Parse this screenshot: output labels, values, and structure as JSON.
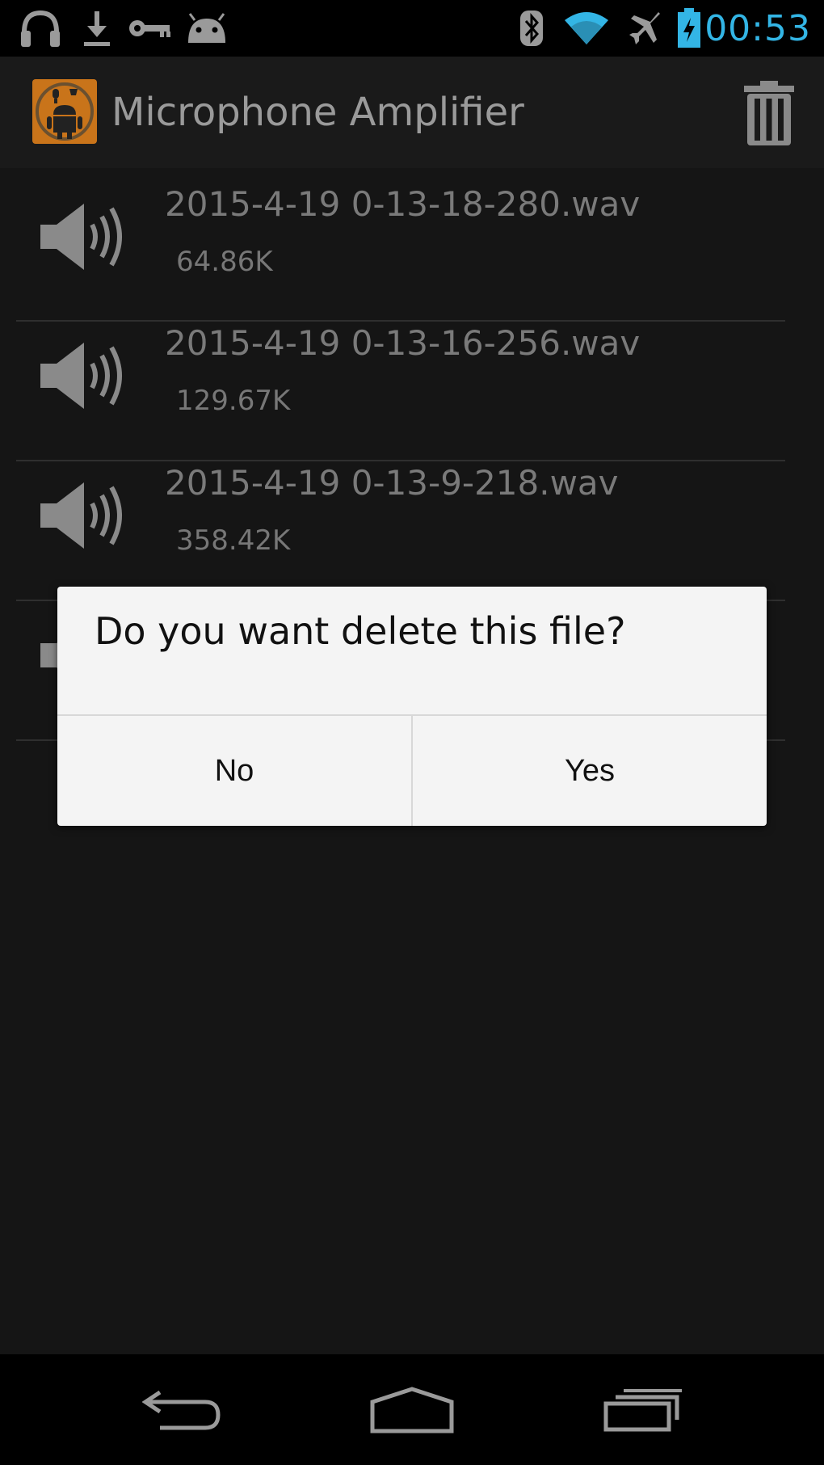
{
  "status_bar": {
    "time": "00:53",
    "left_icons": [
      "headphones-icon",
      "download-icon",
      "key-icon",
      "android-icon"
    ],
    "right_icons": [
      "bluetooth-icon",
      "wifi-icon",
      "airplane-icon",
      "battery-charging-icon"
    ],
    "time_color": "#33b5e5"
  },
  "action_bar": {
    "title": "Microphone Amplifier",
    "app_icon": "app-logo-icon",
    "action_icon": "trash-icon"
  },
  "files": [
    {
      "name": "2015-4-19 0-13-18-280.wav",
      "size": "64.86K"
    },
    {
      "name": "2015-4-19 0-13-16-256.wav",
      "size": "129.67K"
    },
    {
      "name": "2015-4-19 0-13-9-218.wav",
      "size": "358.42K"
    },
    {
      "name": "",
      "size": ""
    }
  ],
  "dialog": {
    "message": "Do you want delete this file?",
    "no_label": "No",
    "yes_label": "Yes"
  },
  "nav_bar": {
    "icons": [
      "back-icon",
      "home-icon",
      "recent-apps-icon"
    ]
  }
}
